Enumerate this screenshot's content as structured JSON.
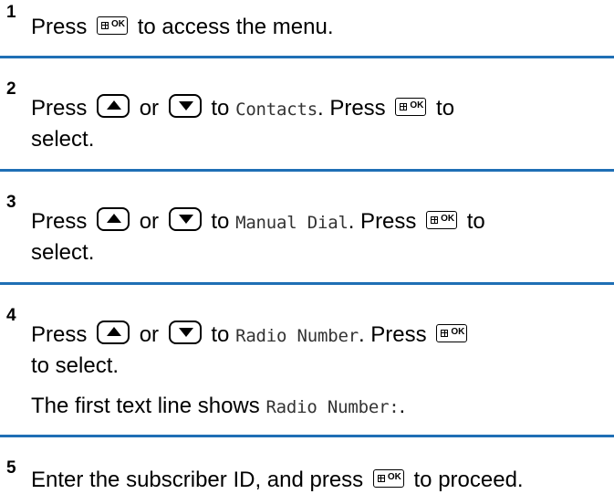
{
  "steps": [
    {
      "number": "1",
      "press": "Press",
      "text_after_ok": "to access the menu."
    },
    {
      "number": "2",
      "press": "Press",
      "or": "or",
      "to": "to",
      "item": "Contacts",
      "press2": ". Press",
      "to_end": "to",
      "select": "select."
    },
    {
      "number": "3",
      "press": "Press",
      "or": "or",
      "to": "to",
      "item": "Manual Dial",
      "press2": ". Press",
      "to_end": "to",
      "select": "select."
    },
    {
      "number": "4",
      "press": "Press",
      "or": "or",
      "to": "to",
      "item": "Radio Number",
      "press2": ". Press",
      "select": "to select.",
      "note_prefix": "The first text line shows",
      "note_item": "Radio Number:",
      "note_suffix": "."
    },
    {
      "number": "5",
      "enter": "Enter the subscriber ID, and press",
      "proceed": "to proceed."
    }
  ],
  "icons": {
    "ok_key_label": "OK",
    "up_key": "up-arrow-key-icon",
    "down_key": "down-arrow-key-icon",
    "menu_ok_key": "menu-ok-key-icon"
  },
  "colors": {
    "rule": "#1f6fb5",
    "text": "#000000"
  }
}
